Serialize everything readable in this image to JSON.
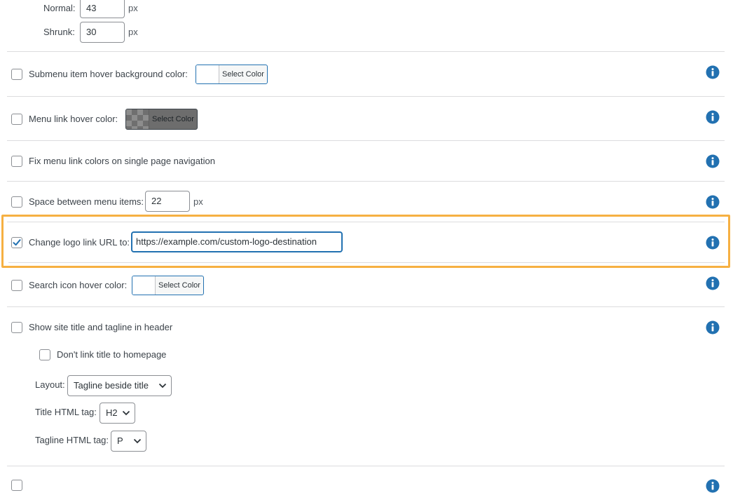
{
  "header_sizes": {
    "normal": {
      "label": "Normal:",
      "value": "43",
      "unit": "px"
    },
    "shrunk": {
      "label": "Shrunk:",
      "value": "30",
      "unit": "px"
    }
  },
  "rows": {
    "submenu_hover_bg": {
      "label": "Submenu item hover background color:",
      "checked": false,
      "button": "Select Color"
    },
    "menu_link_hover": {
      "label": "Menu link hover color:",
      "checked": false,
      "button": "Select Color"
    },
    "fix_menu_link": {
      "label": "Fix menu link colors on single page navigation",
      "checked": false
    },
    "space_between": {
      "label": "Space between menu items:",
      "checked": false,
      "value": "22",
      "unit": "px"
    },
    "logo_link": {
      "label": "Change logo link URL to:",
      "checked": true,
      "value": "https://example.com/custom-logo-destination"
    },
    "search_icon_hover": {
      "label": "Search icon hover color:",
      "checked": false,
      "button": "Select Color"
    },
    "site_title": {
      "label": "Show site title and tagline in header",
      "checked": false,
      "dont_link": {
        "label": "Don't link title to homepage",
        "checked": false
      },
      "layout": {
        "label": "Layout:",
        "value": "Tagline beside title"
      },
      "title_tag": {
        "label": "Title HTML tag:",
        "value": "H2"
      },
      "tagline_tag": {
        "label": "Tagline HTML tag:",
        "value": "P"
      }
    }
  },
  "colors": {
    "accent": "#2271b1",
    "highlight": "#f6b042",
    "separator": "#dcdcde"
  },
  "icons": [
    "info-icon",
    "checkmark-icon",
    "chevron-down-icon"
  ]
}
